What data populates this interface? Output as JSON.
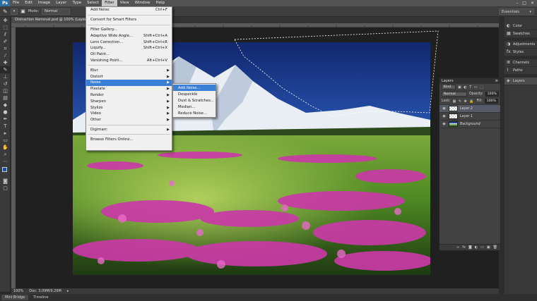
{
  "app": {
    "logo": "Ps"
  },
  "menubar": {
    "items": [
      "File",
      "Edit",
      "Image",
      "Layer",
      "Type",
      "Select",
      "Filter",
      "View",
      "Window",
      "Help"
    ],
    "active": "Filter",
    "controls": [
      "–",
      "□",
      "✕"
    ]
  },
  "options": {
    "mode_label": "Mode:",
    "mode_value": "Normal"
  },
  "workspace": {
    "value": "Essentials"
  },
  "document": {
    "tab_title": "Distraction Removal.psd @ 100% (Layer 2, R"
  },
  "status": {
    "zoom": "100%",
    "doc": "Doc: 3.09M/9.29M"
  },
  "bottom_tabs": [
    "Mini Bridge",
    "Timeline"
  ],
  "filter_menu": {
    "items": [
      {
        "label": "Add Noise",
        "shortcut": "Ctrl+F"
      },
      {
        "sep": true
      },
      {
        "label": "Convert for Smart Filters"
      },
      {
        "sep": true
      },
      {
        "label": "Filter Gallery..."
      },
      {
        "label": "Adaptive Wide Angle...",
        "shortcut": "Shift+Ctrl+A"
      },
      {
        "label": "Lens Correction...",
        "shortcut": "Shift+Ctrl+R"
      },
      {
        "label": "Liquify...",
        "shortcut": "Shift+Ctrl+X"
      },
      {
        "label": "Oil Paint..."
      },
      {
        "label": "Vanishing Point...",
        "shortcut": "Alt+Ctrl+V"
      },
      {
        "sep": true
      },
      {
        "label": "Blur",
        "submenu": true
      },
      {
        "label": "Distort",
        "submenu": true
      },
      {
        "label": "Noise",
        "submenu": true,
        "highlight": true
      },
      {
        "label": "Pixelate",
        "submenu": true
      },
      {
        "label": "Render",
        "submenu": true
      },
      {
        "label": "Sharpen",
        "submenu": true
      },
      {
        "label": "Stylize",
        "submenu": true
      },
      {
        "label": "Video",
        "submenu": true
      },
      {
        "label": "Other",
        "submenu": true
      },
      {
        "sep": true
      },
      {
        "label": "Digimarc",
        "submenu": true
      },
      {
        "sep": true
      },
      {
        "label": "Browse Filters Online..."
      }
    ]
  },
  "noise_menu": {
    "items": [
      {
        "label": "Add Noise...",
        "highlight": true
      },
      {
        "label": "Despeckle"
      },
      {
        "label": "Dust & Scratches..."
      },
      {
        "label": "Median..."
      },
      {
        "label": "Reduce Noise..."
      }
    ]
  },
  "dock": {
    "items": [
      {
        "label": "Color",
        "icon": "color-icon"
      },
      {
        "label": "Swatches",
        "icon": "swatches-icon"
      },
      {
        "label": "Adjustments",
        "icon": "adjustments-icon"
      },
      {
        "label": "Styles",
        "icon": "styles-icon"
      },
      {
        "label": "Channels",
        "icon": "channels-icon"
      },
      {
        "label": "Paths",
        "icon": "paths-icon"
      },
      {
        "label": "Layers",
        "icon": "layers-icon"
      }
    ]
  },
  "layers_panel": {
    "title": "Layers",
    "kind": "Kind",
    "blend": "Normal",
    "opacity_label": "Opacity:",
    "opacity": "100%",
    "lock_label": "Lock:",
    "fill_label": "Fill:",
    "fill": "100%",
    "layers": [
      {
        "name": "Layer 2",
        "selected": true,
        "thumb": "checker"
      },
      {
        "name": "Layer 1",
        "selected": false,
        "thumb": "checker"
      },
      {
        "name": "Background",
        "selected": false,
        "thumb": "photo"
      }
    ]
  }
}
